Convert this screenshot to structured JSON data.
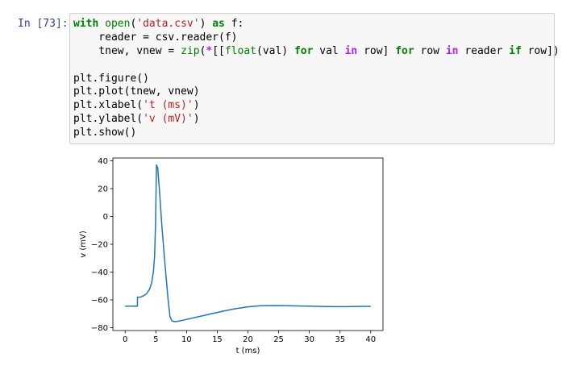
{
  "cell": {
    "prompt": "In [73]:",
    "code": [
      [
        {
          "t": "with",
          "c": "kw"
        },
        {
          "t": " "
        },
        {
          "t": "open",
          "c": "bi"
        },
        {
          "t": "("
        },
        {
          "t": "'data.csv'",
          "c": "str"
        },
        {
          "t": ") "
        },
        {
          "t": "as",
          "c": "kw"
        },
        {
          "t": " f:"
        }
      ],
      [
        {
          "t": "    reader = csv.reader(f)"
        }
      ],
      [
        {
          "t": "    tnew, vnew = "
        },
        {
          "t": "zip",
          "c": "bi"
        },
        {
          "t": "("
        },
        {
          "t": "*",
          "c": "op"
        },
        {
          "t": "[["
        },
        {
          "t": "float",
          "c": "bi"
        },
        {
          "t": "(val) "
        },
        {
          "t": "for",
          "c": "kw"
        },
        {
          "t": " val "
        },
        {
          "t": "in",
          "c": "op"
        },
        {
          "t": " row] "
        },
        {
          "t": "for",
          "c": "kw"
        },
        {
          "t": " row "
        },
        {
          "t": "in",
          "c": "op"
        },
        {
          "t": " reader "
        },
        {
          "t": "if",
          "c": "kw"
        },
        {
          "t": " row])"
        }
      ],
      [
        {
          "t": ""
        }
      ],
      [
        {
          "t": "plt.figure()"
        }
      ],
      [
        {
          "t": "plt.plot(tnew, vnew)"
        }
      ],
      [
        {
          "t": "plt.xlabel("
        },
        {
          "t": "'t (ms)'",
          "c": "str"
        },
        {
          "t": ")"
        }
      ],
      [
        {
          "t": "plt.ylabel("
        },
        {
          "t": "'v (mV)'",
          "c": "str"
        },
        {
          "t": ")"
        }
      ],
      [
        {
          "t": "plt.show()"
        }
      ]
    ]
  },
  "chart_data": {
    "type": "line",
    "xlabel": "t (ms)",
    "ylabel": "v (mV)",
    "xlim": [
      -2,
      42
    ],
    "ylim": [
      -82,
      42
    ],
    "xticks": [
      0,
      5,
      10,
      15,
      20,
      25,
      30,
      35,
      40
    ],
    "yticks": [
      -80,
      -60,
      -40,
      -20,
      0,
      20,
      40
    ],
    "grid": false,
    "line_color": "#1f77b4",
    "series": [
      {
        "x": [
          0,
          2.0,
          2.0,
          2.5,
          3.0,
          3.5,
          4.0,
          4.3,
          4.6,
          4.8,
          4.95,
          5.1,
          5.3,
          5.6,
          6.0,
          6.5,
          7.0,
          7.3,
          7.6,
          8.0,
          8.5,
          9.0,
          10,
          11,
          12,
          14,
          16,
          18,
          20,
          22,
          24,
          26,
          28,
          30,
          32,
          34,
          36,
          38,
          40
        ],
        "y": [
          -64.5,
          -64.5,
          -58,
          -58,
          -57,
          -55.5,
          -52,
          -48,
          -40,
          -28,
          -5,
          37,
          35,
          18,
          -8,
          -35,
          -60,
          -72,
          -75,
          -75.6,
          -75.4,
          -75,
          -74,
          -73,
          -72,
          -70,
          -68,
          -66.3,
          -65,
          -64.2,
          -64,
          -64.1,
          -64.3,
          -64.5,
          -64.7,
          -64.8,
          -64.8,
          -64.7,
          -64.6
        ]
      }
    ]
  }
}
